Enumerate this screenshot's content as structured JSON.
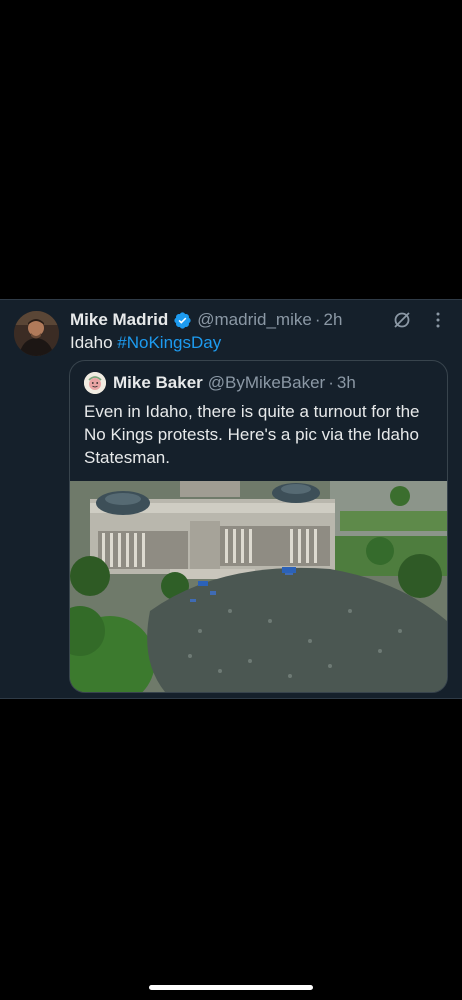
{
  "tweet": {
    "author_name": "Mike Madrid",
    "author_handle": "@madrid_mike",
    "separator": "·",
    "time": "2h",
    "text_plain": "Idaho ",
    "hashtag": "#NoKingsDay",
    "icons": {
      "avatar": "avatar",
      "verified": "verified-badge-icon",
      "grok": "grok-icon",
      "more": "more-icon"
    }
  },
  "quoted": {
    "author_name": "Mike Baker",
    "author_handle": "@ByMikeBaker",
    "separator": "·",
    "time": "3h",
    "text": "Even in Idaho, there is quite a turnout for the No Kings protests. Here's a pic via the Idaho Statesman."
  },
  "colors": {
    "background": "#000000",
    "card": "#15202b",
    "text": "#e7e9ea",
    "muted": "#8b98a5",
    "link": "#1d9bf0",
    "border": "#38444d"
  }
}
